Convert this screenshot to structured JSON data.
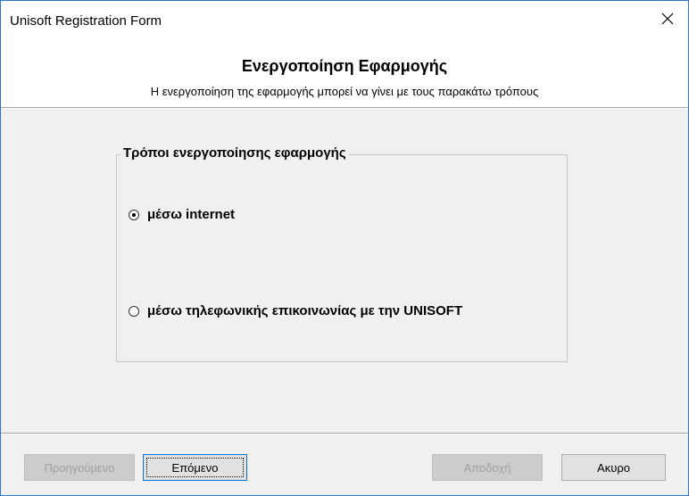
{
  "window": {
    "title": "Unisoft Registration Form"
  },
  "header": {
    "title": "Ενεργοποίηση Εφαρμογής",
    "subtitle": "Η ενεργοποίηση της εφαρμογής μπορεί να γίνει με τους παρακάτω τρόπους"
  },
  "activation_group": {
    "legend": "Τρόποι ενεργοποίησης εφαρμογής",
    "options": [
      {
        "label": "μέσω internet",
        "selected": true
      },
      {
        "label": "μέσω τηλεφωνικής επικοινωνίας με την UNISOFT",
        "selected": false
      }
    ]
  },
  "buttons": {
    "previous": {
      "label": "Προηγούμενο",
      "enabled": false
    },
    "next": {
      "label": "Επόμενο",
      "enabled": true
    },
    "accept": {
      "label": "Αποδοχή",
      "enabled": false
    },
    "cancel": {
      "label": "Ακυρο",
      "enabled": true
    }
  },
  "icons": {
    "close": "close-icon"
  },
  "colors": {
    "window_border": "#2b78d0",
    "dialog_background": "#f0f0f0",
    "header_background": "#ffffff",
    "disabled_text": "#a0a0a0",
    "focus_border": "#0078d7"
  }
}
